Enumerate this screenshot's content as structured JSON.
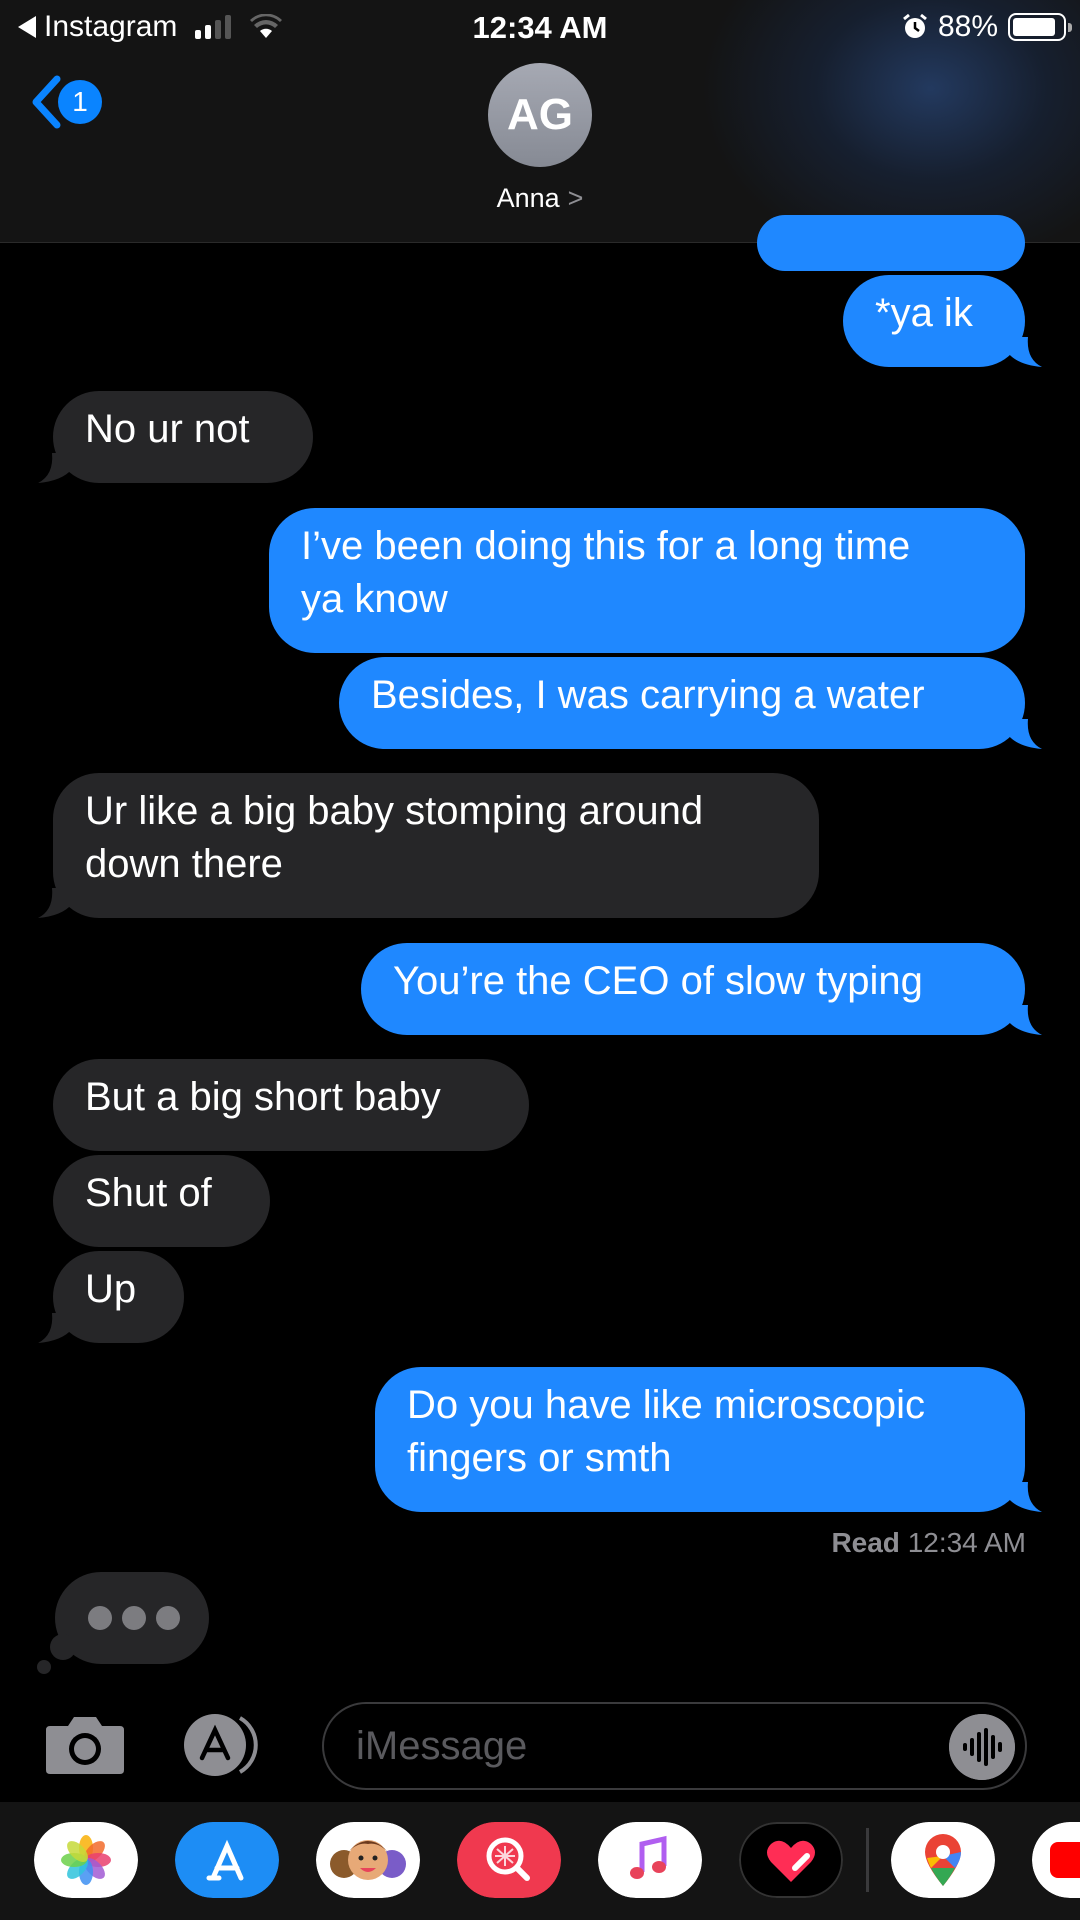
{
  "status_bar": {
    "back_app": "Instagram",
    "time": "12:34 AM",
    "battery": "88%",
    "battery_level": 0.88
  },
  "nav": {
    "back_badge": "1",
    "avatar_initials": "AG",
    "contact_name": "Anna",
    "contact_chevron": ">"
  },
  "messages": [
    {
      "from": "me",
      "text": "*ya ik"
    },
    {
      "from": "them",
      "text": "No ur not"
    },
    {
      "from": "me",
      "lines": [
        "I’ve been doing this for a long time",
        "ya know"
      ]
    },
    {
      "from": "me",
      "text": "Besides, I was carrying a water"
    },
    {
      "from": "them",
      "lines": [
        "Ur like a big baby stomping around",
        "down there"
      ]
    },
    {
      "from": "me",
      "text": "You’re the CEO of slow typing"
    },
    {
      "from": "them",
      "text": "But a big short baby"
    },
    {
      "from": "them",
      "text": "Shut of"
    },
    {
      "from": "them",
      "text": "Up"
    },
    {
      "from": "me",
      "lines": [
        "Do you have like microscopic",
        "fingers or smth"
      ]
    }
  ],
  "receipt": {
    "label": "Read",
    "time": "12:34 AM"
  },
  "typing_indicator": true,
  "composer": {
    "placeholder": "iMessage"
  },
  "app_drawer": [
    "photos-app",
    "app-store-app",
    "memoji-app",
    "images-search-app",
    "music-app",
    "digital-touch-app",
    "maps-app",
    "partial-app"
  ],
  "colors": {
    "sent": "#1f88ff",
    "received": "#262628",
    "background": "#000000",
    "accent": "#0a84ff"
  }
}
